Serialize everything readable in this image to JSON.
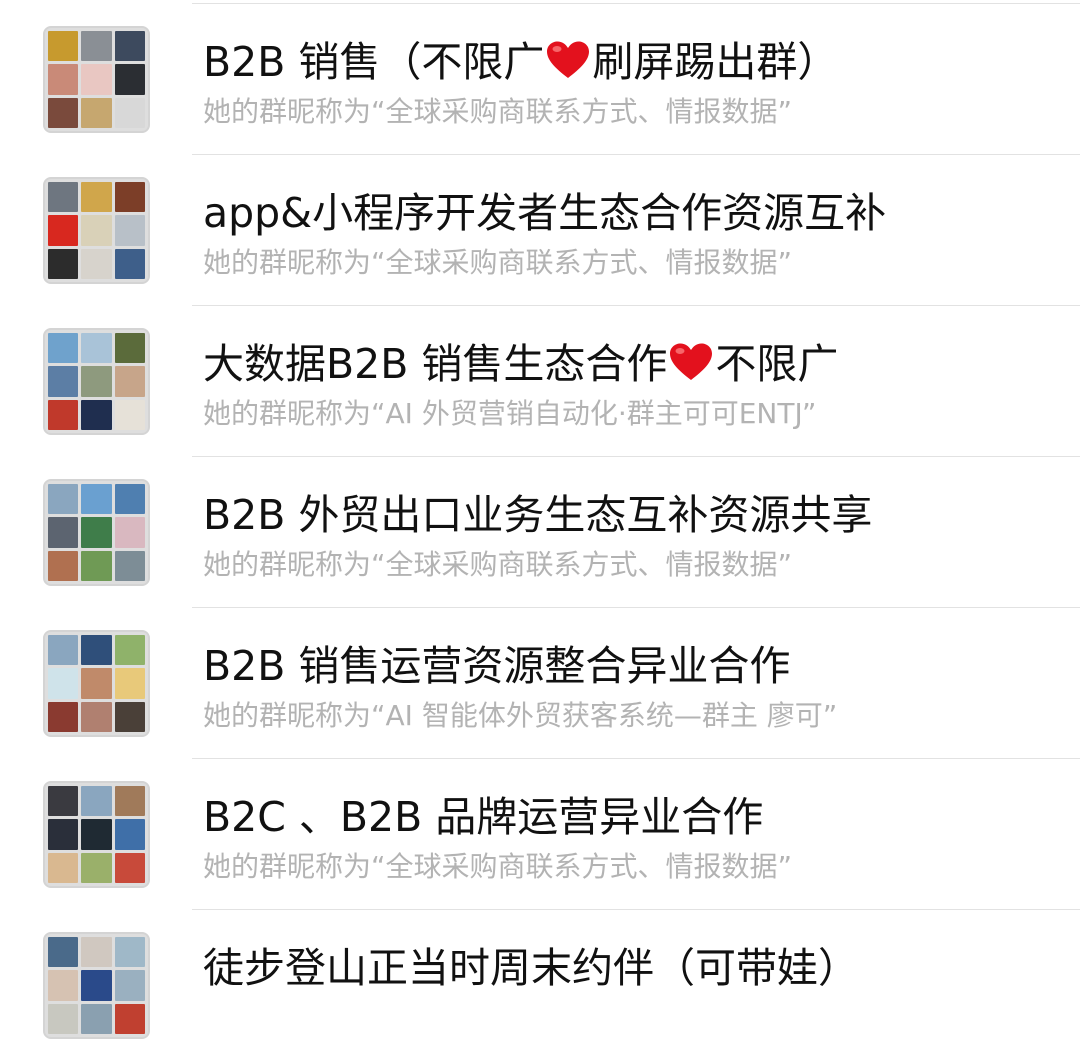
{
  "groups": [
    {
      "title_parts": [
        "B2B 销售（不限广",
        "heart",
        "刷屏踢出群）"
      ],
      "subtitle": "她的群昵称为“全球采购商联系方式、情报数据”",
      "avatar_tiles": [
        "#c79a2e",
        "#8a8f95",
        "#3d4a5e",
        "#c98a78",
        "#e9c7c2",
        "#2b2e33",
        "#7a4a3c",
        "#c6a76f",
        "#d8d8d8"
      ]
    },
    {
      "title_parts": [
        "app&小程序开发者生态合作资源互补"
      ],
      "subtitle": "她的群昵称为“全球采购商联系方式、情报数据”",
      "avatar_tiles": [
        "#6e7680",
        "#d0a64b",
        "#7c3e28",
        "#d8281f",
        "#d9d1b8",
        "#b8c0c8",
        "#2c2c2c",
        "#d7d3cc",
        "#3e5f8a"
      ]
    },
    {
      "title_parts": [
        "大数据B2B 销售生态合作",
        "heart",
        "不限广"
      ],
      "subtitle": "她的群昵称为“AI 外贸营销自动化·群主可可ENTJ”",
      "avatar_tiles": [
        "#6fa2cc",
        "#a9c3d8",
        "#5b6b3b",
        "#5c7ea5",
        "#8e9a7e",
        "#c7a58a",
        "#c0392b",
        "#1f2e4f",
        "#e6e1d8"
      ]
    },
    {
      "title_parts": [
        "B2B 外贸出口业务生态互补资源共享"
      ],
      "subtitle": "她的群昵称为“全球采购商联系方式、情报数据”",
      "avatar_tiles": [
        "#8aa6bf",
        "#6aa0d0",
        "#4f7fb0",
        "#5c6470",
        "#3f7d4a",
        "#d9b8c0",
        "#b07050",
        "#6f9a55",
        "#7d8d96"
      ]
    },
    {
      "title_parts": [
        "B2B 销售运营资源整合异业合作"
      ],
      "subtitle": "她的群昵称为“AI 智能体外贸获客系统—群主 廖可”",
      "avatar_tiles": [
        "#8aa6bf",
        "#2f4f7a",
        "#8fb26a",
        "#cfe3ea",
        "#c08a6a",
        "#e8c97a",
        "#8a3a30",
        "#b08070",
        "#4a4038"
      ]
    },
    {
      "title_parts": [
        "B2C 、B2B 品牌运营异业合作"
      ],
      "subtitle": "她的群昵称为“全球采购商联系方式、情报数据”",
      "avatar_tiles": [
        "#3a3a40",
        "#8aa6bf",
        "#a07a5a",
        "#2a2f3a",
        "#1f2a33",
        "#3f6fa8",
        "#d9b890",
        "#9ab06a",
        "#c84a3a"
      ]
    },
    {
      "title_parts": [
        "徒步登山正当时周末约伴（可带娃）"
      ],
      "subtitle": "",
      "avatar_tiles": [
        "#4a6a8a",
        "#d0c8c0",
        "#9fb8c8",
        "#d6c2b2",
        "#2a4a8a",
        "#9ab0c0",
        "#c8c8c0",
        "#8aa0b0",
        "#c04030"
      ]
    }
  ]
}
